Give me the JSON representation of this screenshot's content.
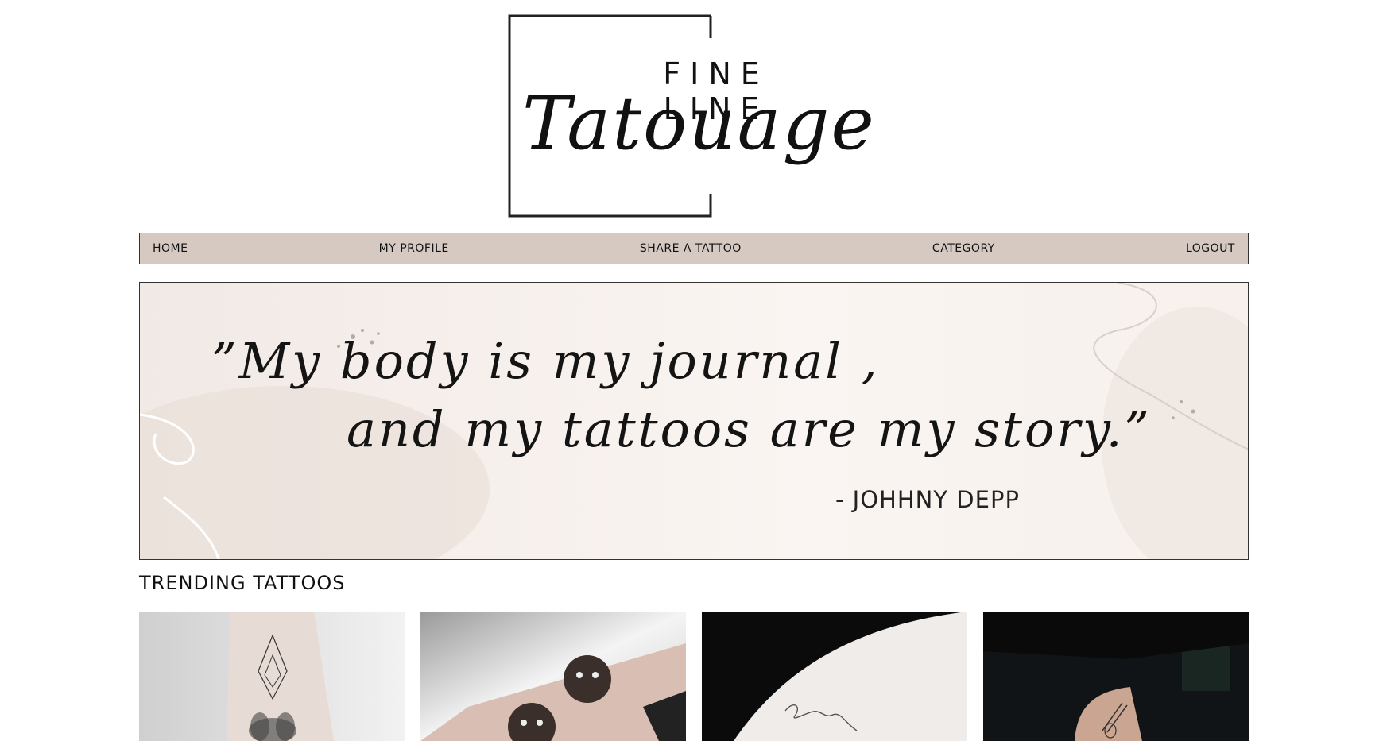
{
  "brand": {
    "logo_top": "FINE LINE",
    "logo_script": "Tatouage"
  },
  "nav": {
    "items": [
      {
        "label": "HOME"
      },
      {
        "label": "MY PROFILE"
      },
      {
        "label": "SHARE A TATTOO"
      },
      {
        "label": "CATEGORY"
      },
      {
        "label": "LOGOUT"
      }
    ]
  },
  "banner": {
    "quote_line_1": "”My body is my journal ,",
    "quote_line_2": "and my tattoos are my story.”",
    "author": "-  JOHHNY DEPP"
  },
  "trending": {
    "title": "TRENDING TATTOOS",
    "cards": [
      {
        "icon": "lotus-geometric-tattoo-image"
      },
      {
        "icon": "dog-portrait-tattoo-image"
      },
      {
        "icon": "script-word-tattoo-image"
      },
      {
        "icon": "fine-line-arm-tattoo-image"
      }
    ]
  },
  "colors": {
    "nav_bg": "#d6c9c2",
    "banner_bg": "#f6efeb",
    "text": "#111111"
  }
}
